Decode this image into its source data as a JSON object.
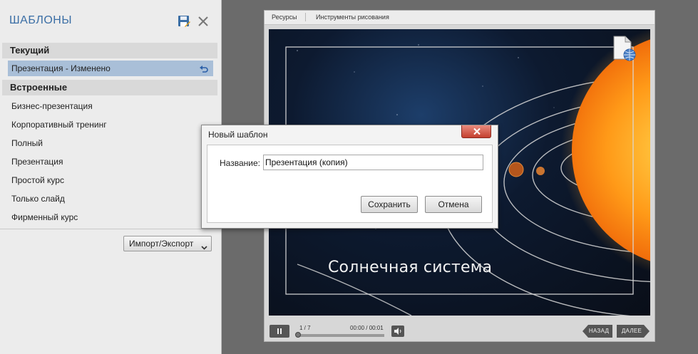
{
  "templates_panel": {
    "title": "ШАБЛОНЫ",
    "save_icon": "save-icon",
    "close_icon": "close-icon",
    "current_section": "Текущий",
    "current_item": "Презентация - Изменено",
    "builtin_section": "Встроенные",
    "builtin_items": [
      "Бизнес-презентация",
      "Корпоративный тренинг",
      "Полный",
      "Презентация",
      "Простой курс",
      "Только слайд",
      "Фирменный курс"
    ],
    "import_export_label": "Импорт/Экспорт"
  },
  "player": {
    "tabs": [
      "Ресурсы",
      "Инструменты рисования"
    ],
    "slide_title": "Солнечная система",
    "slide_counter": "1 / 7",
    "time": "00:00 / 00:01",
    "progress_fraction": 0.0,
    "back_label": "НАЗАД",
    "next_label": "ДАЛЕЕ"
  },
  "dialog": {
    "title": "Новый шаблон",
    "name_label": "Название:",
    "name_value": "Презентация (копия)",
    "save_label": "Сохранить",
    "cancel_label": "Отмена"
  },
  "colors": {
    "panel_title": "#3a6ea5",
    "selected_row": "#a9bfd8",
    "dialog_close": "#c4402f"
  }
}
